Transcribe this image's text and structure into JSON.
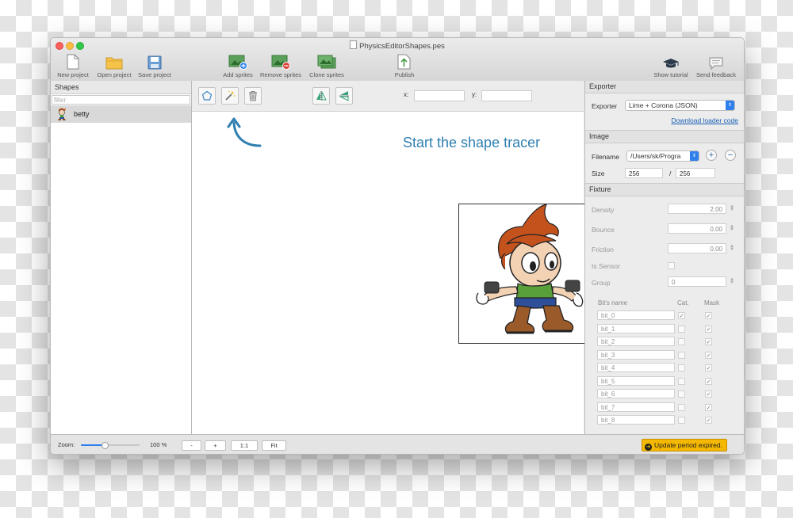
{
  "window": {
    "title": "PhysicsEditorShapes.pes"
  },
  "toolbar": {
    "new_project": "New project",
    "open_project": "Open project",
    "save_project": "Save project",
    "add_sprites": "Add sprites",
    "remove_sprites": "Remove sprites",
    "clone_sprites": "Clone sprites",
    "publish": "Publish",
    "show_tutorial": "Show tutorial",
    "send_feedback": "Send feedback"
  },
  "shapes_panel": {
    "title": "Shapes",
    "filter_placeholder": "filter",
    "items": [
      {
        "name": "betty"
      }
    ]
  },
  "canvas": {
    "x_label": "x:",
    "y_label": "y:",
    "x_value": "",
    "y_value": "",
    "hint": "Start the shape tracer"
  },
  "exporter": {
    "title": "Exporter",
    "label": "Exporter",
    "value": "Lime + Corona (JSON)",
    "download_link": "Download loader code"
  },
  "image": {
    "title": "Image",
    "filename_label": "Filename",
    "filename_value": "/Users/sk/Progra",
    "size_label": "Size",
    "width": "256",
    "separator": "/",
    "height": "256"
  },
  "fixture": {
    "title": "Fixture",
    "density_label": "Density",
    "density": "2.00",
    "bounce_label": "Bounce",
    "bounce": "0.00",
    "friction_label": "Friction",
    "friction": "0.00",
    "is_sensor_label": "Is Sensor",
    "group_label": "Group",
    "group": "0",
    "bits_header": {
      "name": "Bit's name",
      "cat": "Cat.",
      "mask": "Mask"
    },
    "bits": [
      {
        "name": "bit_0",
        "cat": true,
        "mask": true
      },
      {
        "name": "bit_1",
        "cat": false,
        "mask": true
      },
      {
        "name": "bit_2",
        "cat": false,
        "mask": true
      },
      {
        "name": "bit_3",
        "cat": false,
        "mask": true
      },
      {
        "name": "bit_4",
        "cat": false,
        "mask": true
      },
      {
        "name": "bit_5",
        "cat": false,
        "mask": true
      },
      {
        "name": "bit_6",
        "cat": false,
        "mask": true
      },
      {
        "name": "bit_7",
        "cat": false,
        "mask": true
      },
      {
        "name": "bit_8",
        "cat": false,
        "mask": true
      }
    ]
  },
  "status": {
    "zoom_label": "Zoom:",
    "zoom_value": "100 %",
    "zoom_level": 0.4,
    "minus": "-",
    "plus": "+",
    "one_to_one": "1:1",
    "fit": "Fit",
    "update_notice": "Update period expired.",
    "update_color": "#f5b800"
  }
}
